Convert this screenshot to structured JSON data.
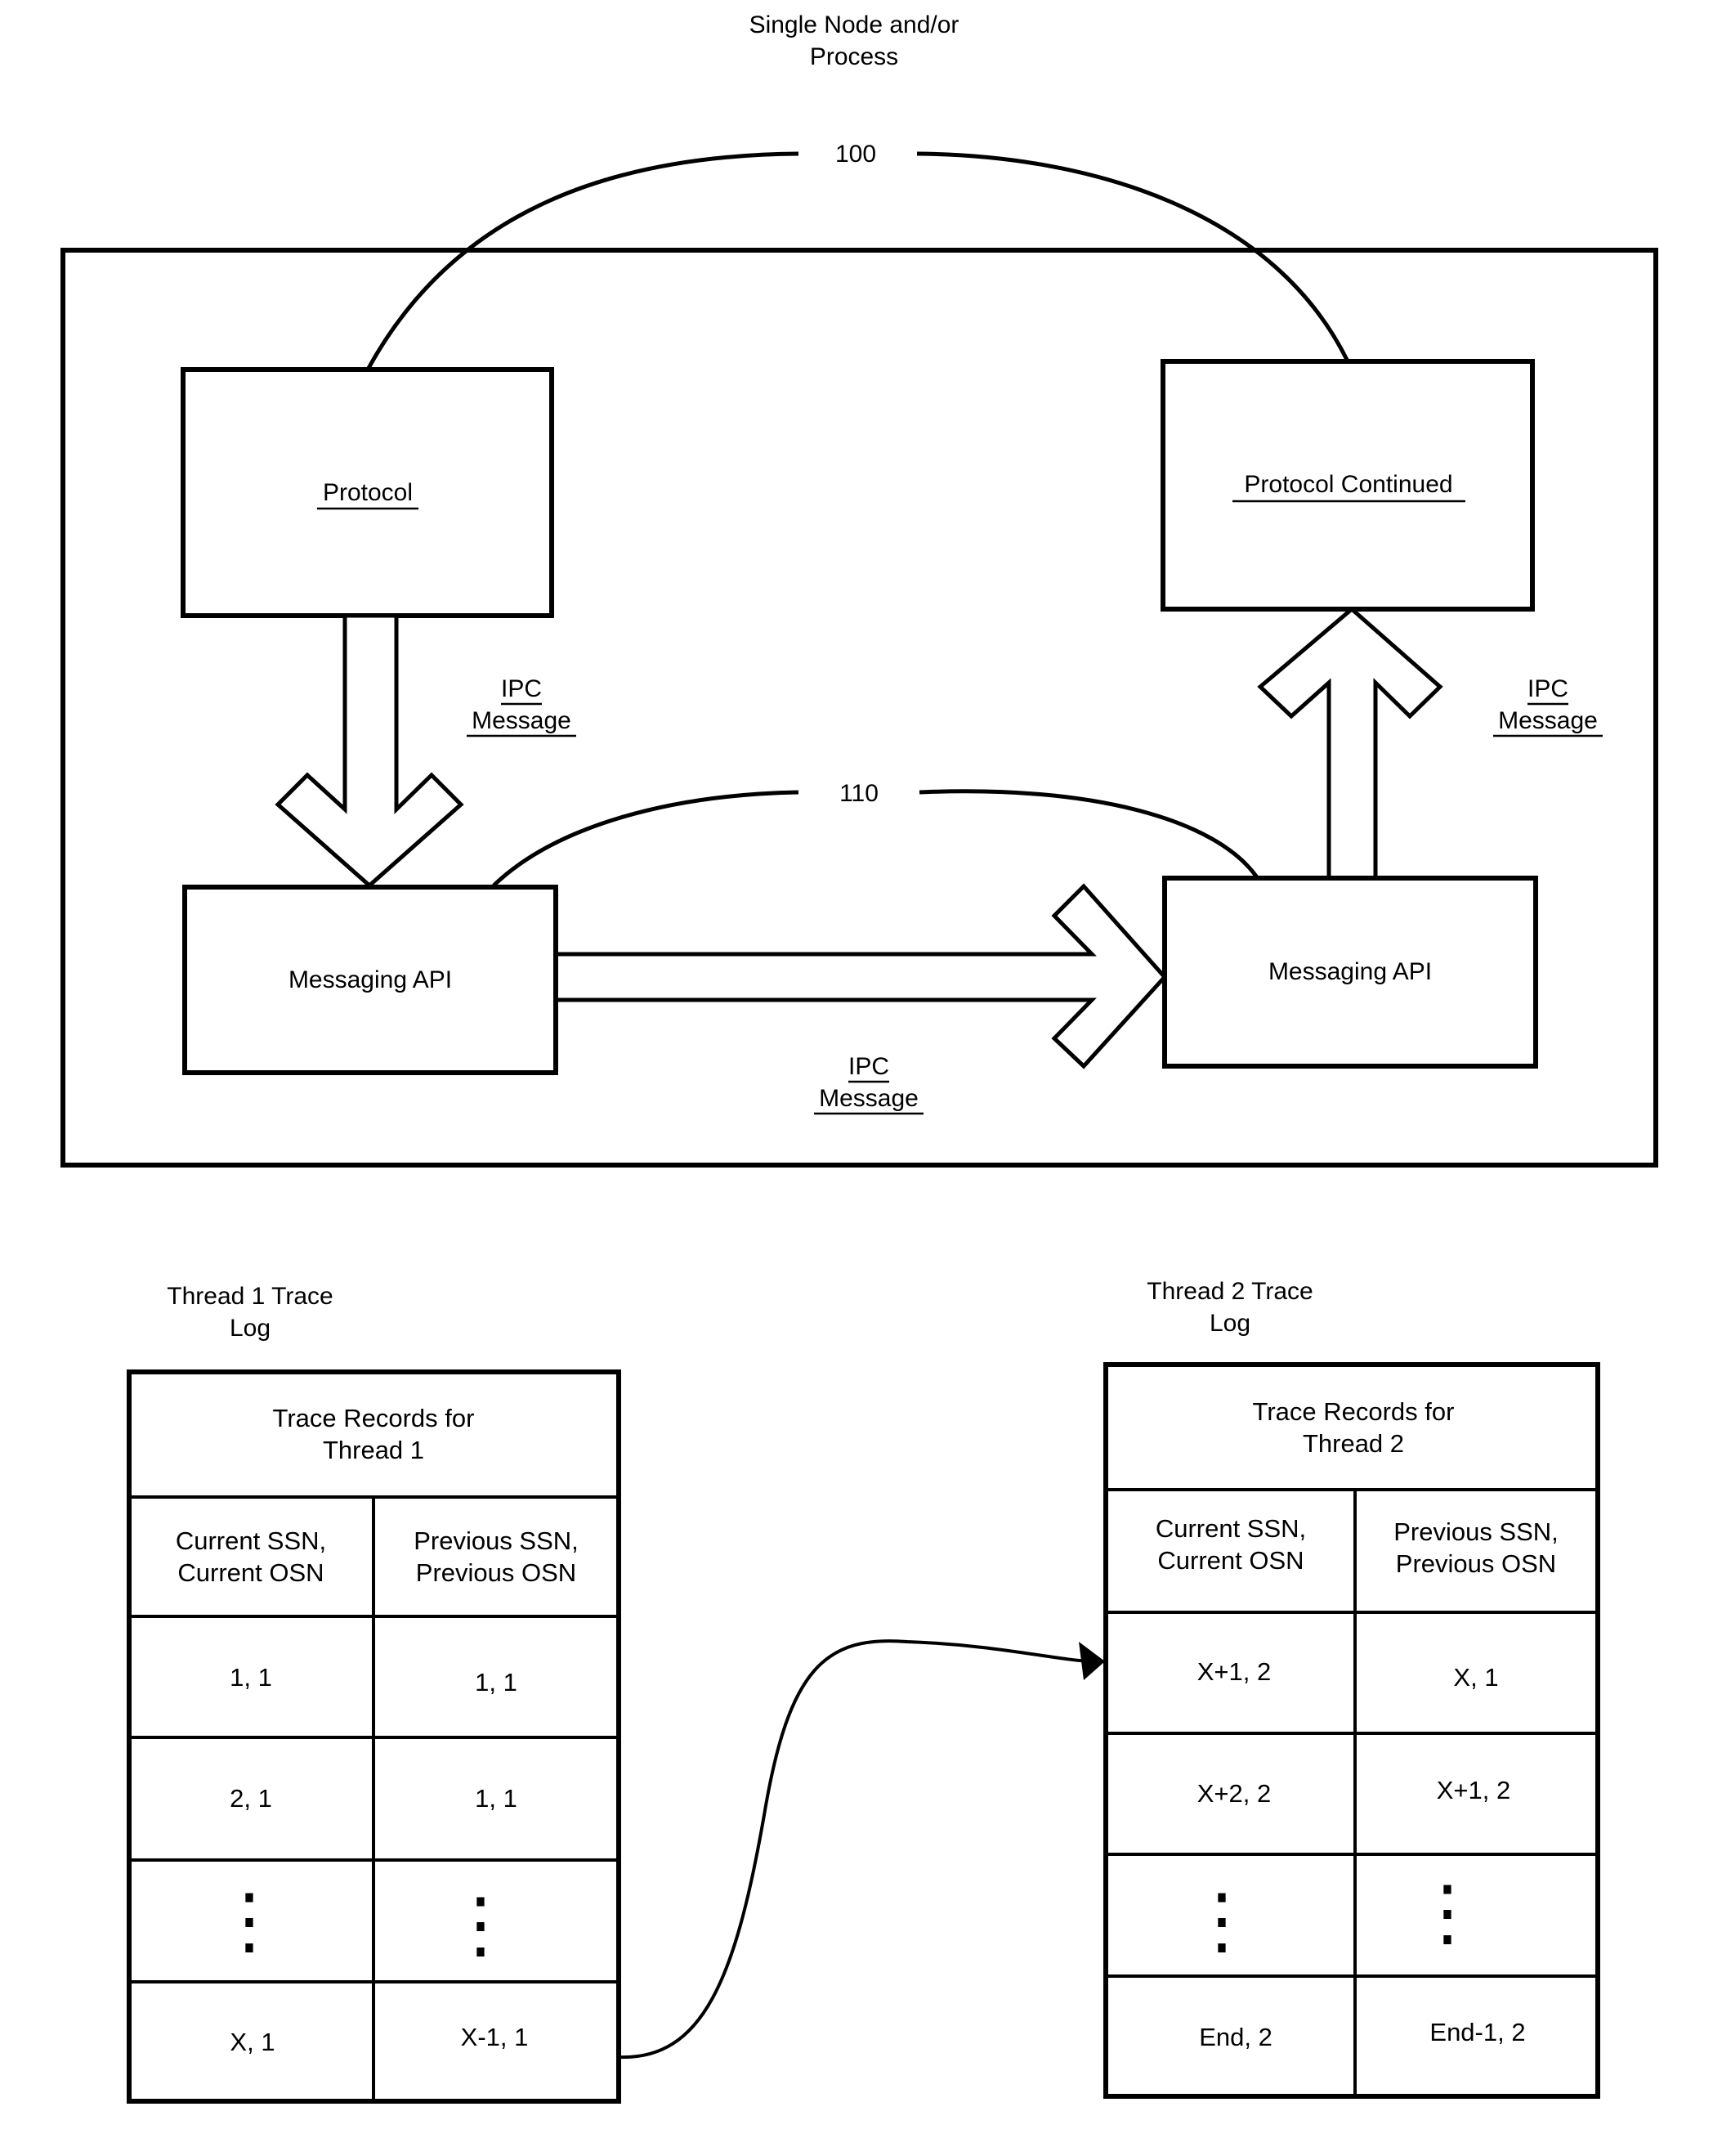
{
  "diagram": {
    "title_lines": [
      "Single Node and/or",
      "Process"
    ],
    "ref_outer": "100",
    "ref_inner": "110",
    "boxes": {
      "protocol": "Protocol",
      "protocol_continued": "Protocol Continued",
      "messaging_api_left": "Messaging API",
      "messaging_api_right": "Messaging API"
    },
    "ipc_labels": {
      "down": [
        "IPC",
        "Message"
      ],
      "up": [
        "IPC",
        "Message"
      ],
      "horizontal": [
        "IPC",
        "Message"
      ]
    }
  },
  "thread1": {
    "title_lines": [
      "Thread 1 Trace",
      "Log"
    ],
    "header_lines": [
      "Trace Records for",
      "Thread 1"
    ],
    "columns": [
      [
        "Current SSN,",
        "Current OSN"
      ],
      [
        "Previous SSN,",
        "Previous OSN"
      ]
    ],
    "rows": [
      [
        "1, 1",
        "1, 1"
      ],
      [
        "2, 1",
        "1, 1"
      ],
      [
        "⋮",
        "⋮"
      ],
      [
        "X, 1",
        "X-1, 1"
      ]
    ]
  },
  "thread2": {
    "title_lines": [
      "Thread 2 Trace",
      "Log"
    ],
    "header_lines": [
      "Trace Records for",
      "Thread 2"
    ],
    "columns": [
      [
        "Current SSN,",
        "Current OSN"
      ],
      [
        "Previous SSN,",
        "Previous OSN"
      ]
    ],
    "rows": [
      [
        "X+1, 2",
        "X, 1"
      ],
      [
        "X+2, 2",
        "X+1, 2"
      ],
      [
        "⋮",
        "⋮"
      ],
      [
        "End, 2",
        "End-1, 2"
      ]
    ]
  }
}
